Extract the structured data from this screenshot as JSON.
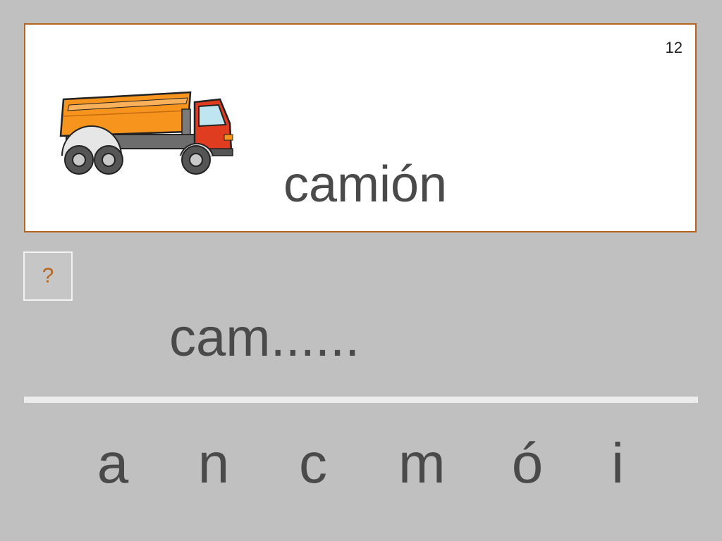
{
  "card": {
    "page_number": "12",
    "word": "camión",
    "image_icon": "dump-truck-icon"
  },
  "hint_button": {
    "label": "?"
  },
  "partial_word": "cam......",
  "letters": [
    "a",
    "n",
    "c",
    "m",
    "ó",
    "i"
  ],
  "colors": {
    "background": "#c0c0c0",
    "card_border": "#b5651d",
    "text": "#4a4a4a",
    "hint": "#b5651d",
    "truck_body": "#f7941d",
    "truck_cab": "#e03c1f"
  }
}
